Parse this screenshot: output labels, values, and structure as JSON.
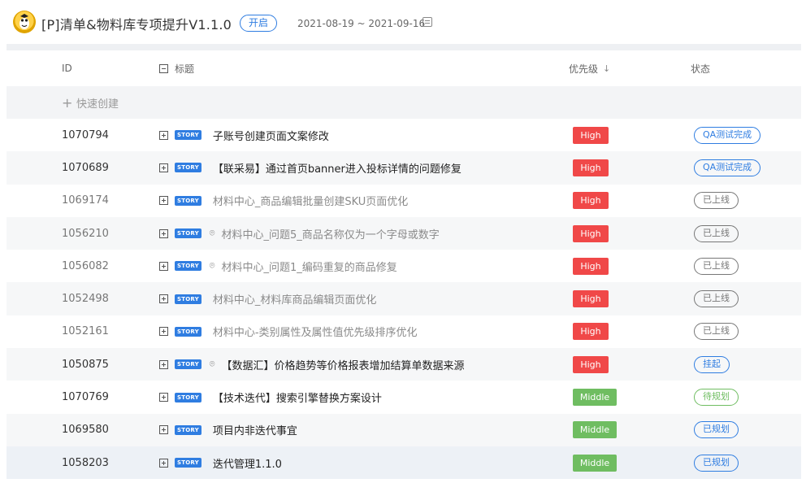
{
  "header": {
    "title": "[P]清单&物料库专项提升V1.1.0",
    "state": "开启",
    "date_range": "2021-08-19 ~ 2021-09-16"
  },
  "table": {
    "columns": {
      "id": "ID",
      "title": "标题",
      "priority": "优先级",
      "status": "状态"
    },
    "quick_create": "快速创建",
    "story_tag": "STORY",
    "rows": [
      {
        "id": "1070794",
        "title": "子账号创建页面文案修改",
        "priority": "High",
        "status": "QA测试完成",
        "muted": false,
        "attachment": false
      },
      {
        "id": "1070689",
        "title": "【联采易】通过首页banner进入投标详情的问题修复",
        "priority": "High",
        "status": "QA测试完成",
        "muted": false,
        "attachment": false
      },
      {
        "id": "1069174",
        "title": "材料中心_商品编辑批量创建SKU页面优化",
        "priority": "High",
        "status": "已上线",
        "muted": true,
        "attachment": false
      },
      {
        "id": "1056210",
        "title": "材料中心_问题5_商品名称仅为一个字母或数字",
        "priority": "High",
        "status": "已上线",
        "muted": true,
        "attachment": true
      },
      {
        "id": "1056082",
        "title": "材料中心_问题1_编码重复的商品修复",
        "priority": "High",
        "status": "已上线",
        "muted": true,
        "attachment": true
      },
      {
        "id": "1052498",
        "title": "材料中心_材料库商品编辑页面优化",
        "priority": "High",
        "status": "已上线",
        "muted": true,
        "attachment": false
      },
      {
        "id": "1052161",
        "title": "材料中心-类别属性及属性值优先级排序优化",
        "priority": "High",
        "status": "已上线",
        "muted": true,
        "attachment": false
      },
      {
        "id": "1050875",
        "title": "【数据汇】价格趋势等价格报表增加结算单数据来源",
        "priority": "High",
        "status": "挂起",
        "muted": false,
        "attachment": true
      },
      {
        "id": "1070769",
        "title": "【技术迭代】搜索引擎替换方案设计",
        "priority": "Middle",
        "status": "待规划",
        "muted": false,
        "attachment": false
      },
      {
        "id": "1069580",
        "title": "项目内非迭代事宜",
        "priority": "Middle",
        "status": "已规划",
        "muted": false,
        "attachment": false
      },
      {
        "id": "1058203",
        "title": "迭代管理1.1.0",
        "priority": "Middle",
        "status": "已规划",
        "muted": false,
        "attachment": false
      }
    ]
  },
  "colors": {
    "accent": "#2f7de1",
    "high": "#f04848",
    "middle": "#6fbd61"
  }
}
